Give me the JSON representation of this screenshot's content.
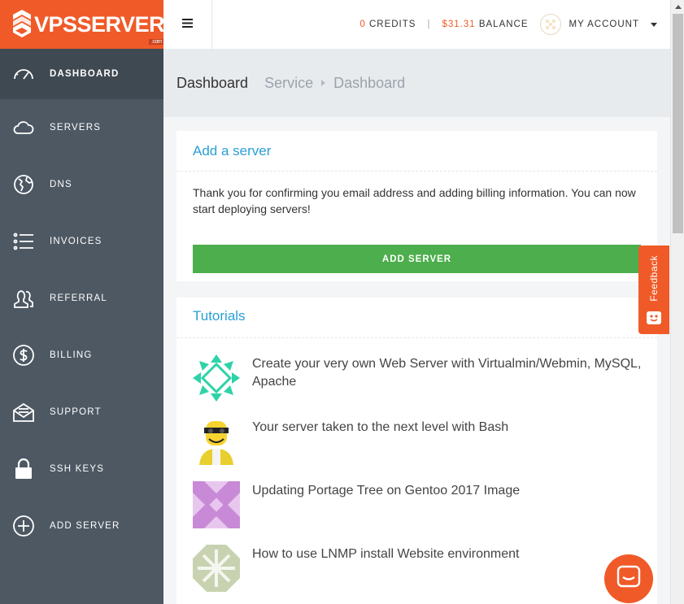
{
  "brand": {
    "name": "VPSSERVER",
    "suffix": ".com"
  },
  "sidebar": {
    "items": [
      {
        "label": "DASHBOARD",
        "icon": "gauge-icon"
      },
      {
        "label": "SERVERS",
        "icon": "cloud-icon"
      },
      {
        "label": "DNS",
        "icon": "globe-icon"
      },
      {
        "label": "INVOICES",
        "icon": "list-icon"
      },
      {
        "label": "REFERRAL",
        "icon": "users-icon"
      },
      {
        "label": "BILLING",
        "icon": "dollar-icon"
      },
      {
        "label": "SUPPORT",
        "icon": "envelope-icon"
      },
      {
        "label": "SSH KEYS",
        "icon": "lock-icon"
      },
      {
        "label": "ADD SERVER",
        "icon": "plus-circle-icon"
      }
    ]
  },
  "topbar": {
    "credits_value": "0",
    "credits_label": "CREDITS",
    "separator": "|",
    "balance_value": "$31.31",
    "balance_label": "BALANCE",
    "account_label": "MY ACCOUNT"
  },
  "page": {
    "title": "Dashboard",
    "breadcrumb": [
      "Service",
      "Dashboard"
    ]
  },
  "add_server_card": {
    "title": "Add a server",
    "message": "Thank you for confirming you email address and adding billing information. You can now start deploying servers!",
    "button_label": "ADD SERVER"
  },
  "tutorials_card": {
    "title": "Tutorials",
    "items": [
      {
        "text": "Create your very own Web Server with Virtualmin/Webmin, MySQL, Apache"
      },
      {
        "text": "Your server taken to the next level with Bash"
      },
      {
        "text": "Updating Portage Tree on Gentoo 2017 Image"
      },
      {
        "text": "How to use LNMP install Website environment"
      }
    ]
  },
  "feedback": {
    "label": "Feedback"
  },
  "colors": {
    "brand": "#f05a28",
    "sidebar": "#4d5863",
    "link": "#2a9fd6",
    "success": "#4cae4c"
  }
}
